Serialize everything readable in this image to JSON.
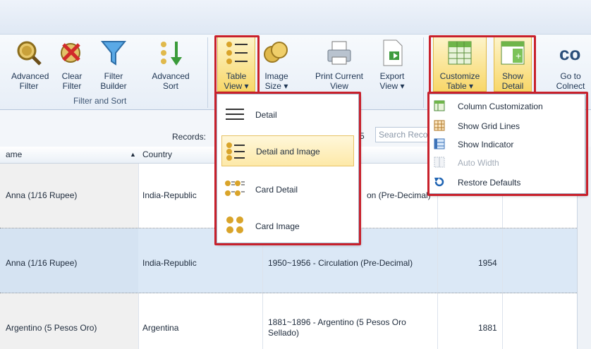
{
  "ribbon": {
    "buttons": [
      {
        "l1": "Advanced",
        "l2": "Filter"
      },
      {
        "l1": "Clear",
        "l2": "Filter"
      },
      {
        "l1": "Filter",
        "l2": "Builder"
      },
      {
        "l1": "Advanced",
        "l2": "Sort"
      },
      {
        "l1": "Table",
        "l2": "View ▾"
      },
      {
        "l1": "Image",
        "l2": "Size ▾"
      },
      {
        "l1": "Print Current",
        "l2": "View"
      },
      {
        "l1": "Export",
        "l2": "View ▾"
      },
      {
        "l1": "Customize",
        "l2": "Table ▾"
      },
      {
        "l1": "Show",
        "l2": "Detail"
      },
      {
        "l1": "Go to",
        "l2": "Colnect"
      }
    ],
    "group_label": "Filter and Sort"
  },
  "toolbar": {
    "records_label": "Records:",
    "count_fragment": "5",
    "search_placeholder": "Search Records"
  },
  "grid": {
    "columns": [
      "ame",
      "Country"
    ],
    "rows": [
      {
        "name": "Anna (1/16 Rupee)",
        "country": "India-Republic",
        "series": "on (Pre-Decimal)",
        "year": ""
      },
      {
        "name": "Anna (1/16 Rupee)",
        "country": "India-Republic",
        "series": "1950~1956 - Circulation (Pre-Decimal)",
        "year": "1954"
      },
      {
        "name": "Argentino (5 Pesos Oro)",
        "country": "Argentina",
        "series_l1": "1881~1896 - Argentino (5 Pesos Oro",
        "series_l2": "Sellado)",
        "year": "1881"
      }
    ]
  },
  "table_view_menu": {
    "items": [
      "Detail",
      "Detail and Image",
      "Card Detail",
      "Card Image"
    ]
  },
  "customize_menu": {
    "items": [
      {
        "label": "Column Customization",
        "enabled": true
      },
      {
        "label": "Show Grid Lines",
        "enabled": true
      },
      {
        "label": "Show Indicator",
        "enabled": true
      },
      {
        "label": "Auto Width",
        "enabled": false
      },
      {
        "label": "Restore Defaults",
        "enabled": true
      }
    ]
  },
  "colors": {
    "highlight": "#c8202b",
    "selected_row": "#dbe8f6",
    "active_button": "#f8d769"
  }
}
